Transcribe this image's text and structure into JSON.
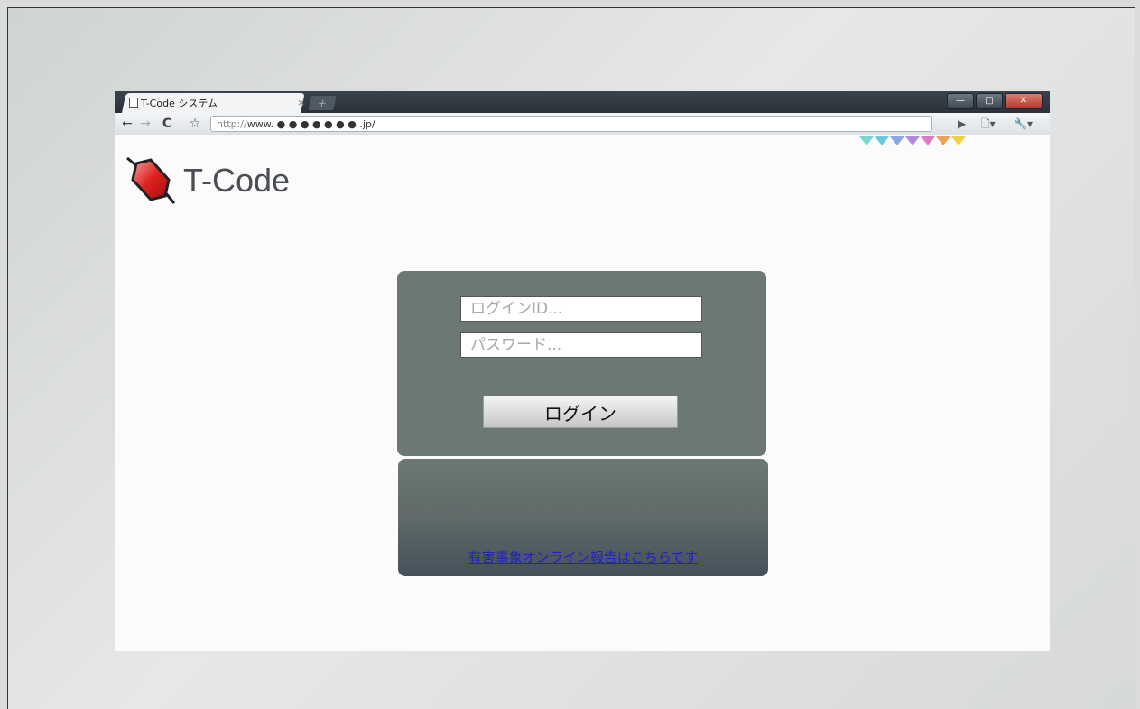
{
  "browser": {
    "tab_title": "T-Code システム",
    "tab_close": "×",
    "new_tab": "+",
    "url_scheme": "http://",
    "url_rest": "www. ● ● ● ● ● ● ● .jp/",
    "window_controls": {
      "minimize": "—",
      "maximize": "□",
      "close": "✕"
    }
  },
  "toolbar": {
    "back": "←",
    "forward": "→",
    "reload": "C",
    "star": "☆",
    "play_icon": "▶",
    "page_menu": "🗋▾",
    "tools_menu": "🔧▾"
  },
  "app": {
    "logo_text": "T-Code"
  },
  "login": {
    "id_placeholder": "ログインID...",
    "password_placeholder": "パスワード...",
    "button_label": "ログイン",
    "report_link": "有害事象オンライン報告はこちらです"
  },
  "colors": {
    "panel": "#6c7876",
    "link": "#2020c8",
    "ribbon": [
      "#7ad6d0",
      "#6ec8e0",
      "#8aa6e6",
      "#b08ae0",
      "#e07ac0",
      "#f0a050",
      "#f0d040"
    ]
  }
}
